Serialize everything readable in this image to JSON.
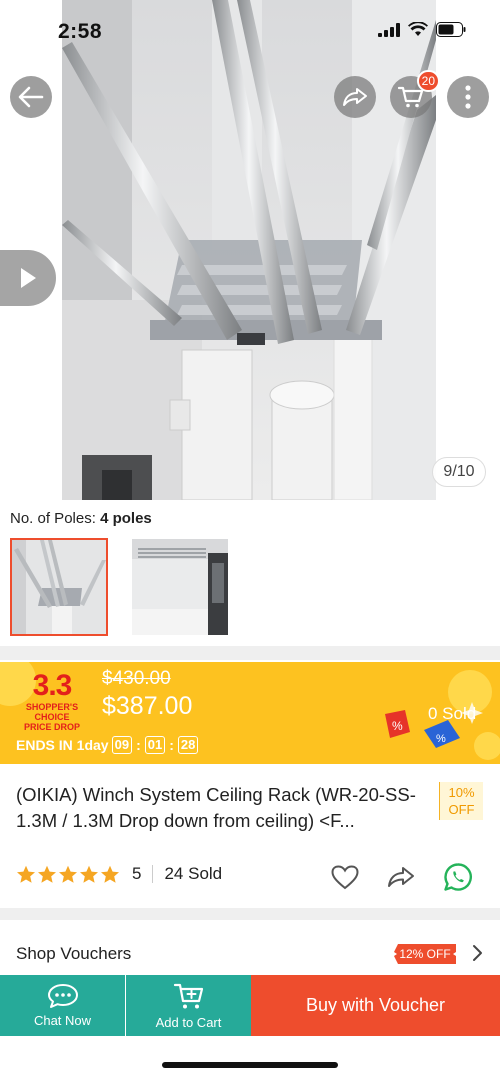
{
  "status_bar": {
    "time": "2:58"
  },
  "gallery": {
    "position": "9/10",
    "cart_count": "20"
  },
  "variation": {
    "label": "No. of Poles:",
    "value": "4 poles"
  },
  "promo": {
    "logo_big": "3.3",
    "logo_line1": "SHOPPER'S",
    "logo_line2": "CHOICE",
    "logo_line3": "PRICE DROP",
    "original_price": "$430.00",
    "price": "$387.00",
    "ends_label": "ENDS IN 1day",
    "timer": {
      "hours": "09",
      "minutes": "01",
      "seconds": "28"
    },
    "sold": "0 Sold"
  },
  "product": {
    "title": "(OIKIA) Winch System Ceiling Rack (WR-20-SS-1.3M / 1.3M Drop down from ceiling) <F...",
    "discount": "10%",
    "discount_suffix": "OFF",
    "rating": "5",
    "rating_stars": 5,
    "sold": "24 Sold"
  },
  "vouchers": {
    "label": "Shop Vouchers",
    "tag": "12% OFF"
  },
  "bottom_bar": {
    "chat": "Chat Now",
    "add_to_cart": "Add to Cart",
    "buy": "Buy with Voucher"
  },
  "colors": {
    "brand": "#ee4d2d",
    "teal": "#26aa99",
    "promo_yellow": "#fdc220",
    "star": "#f5a623"
  },
  "icons": [
    "back-arrow-icon",
    "share-icon",
    "cart-icon",
    "more-icon",
    "play-icon",
    "heart-icon",
    "whatsapp-icon",
    "chat-icon",
    "add-cart-icon",
    "chevron-right-icon"
  ]
}
